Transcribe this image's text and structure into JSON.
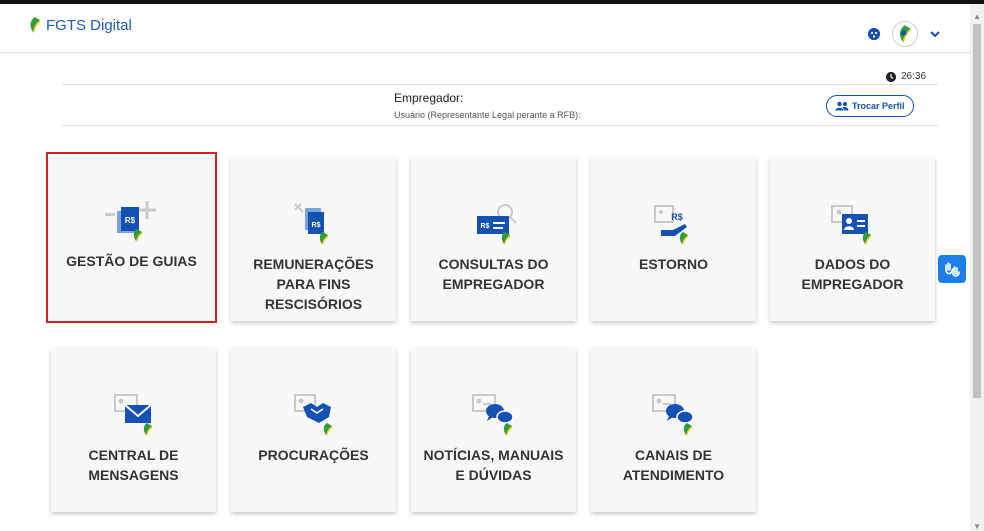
{
  "header": {
    "brand": "FGTS Digital",
    "logo_icon": "fgts-leaf-logo",
    "accessibility_icon": "accessibility-icon",
    "avatar_icon": "user-avatar-icon",
    "menu_icon": "chevron-down-icon"
  },
  "session": {
    "timer": "26:36"
  },
  "profile": {
    "label": "Empregador:",
    "subtitle": "Usuário (Representante Legal perante a RFB):",
    "switch_button": "Trocar Perfil"
  },
  "cards": [
    {
      "lines": [
        "GESTÃO DE GUIAS"
      ],
      "icon": "guide-management-icon",
      "selected": true
    },
    {
      "lines": [
        "REMUNERAÇÕES",
        "PARA FINS",
        "RESCISÓRIOS"
      ],
      "icon": "remuneration-icon"
    },
    {
      "lines": [
        "CONSULTAS DO",
        "EMPREGADOR"
      ],
      "icon": "employer-query-icon"
    },
    {
      "lines": [
        "ESTORNO"
      ],
      "icon": "refund-icon"
    },
    {
      "lines": [
        "DADOS DO",
        "EMPREGADOR"
      ],
      "icon": "employer-data-icon"
    },
    {
      "lines": [
        "CENTRAL DE",
        "MENSAGENS"
      ],
      "icon": "message-center-icon"
    },
    {
      "lines": [
        "PROCURAÇÕES"
      ],
      "icon": "power-of-attorney-icon"
    },
    {
      "lines": [
        "NOTÍCIAS, MANUAIS",
        "E DÚVIDAS"
      ],
      "icon": "news-manuals-icon"
    },
    {
      "lines": [
        "CANAIS DE",
        "ATENDIMENTO"
      ],
      "icon": "service-channels-icon"
    }
  ],
  "colors": {
    "primary": "#1351b4",
    "selected_border": "#d32020",
    "card_bg": "#f8f8f8",
    "libras_button": "#1c7ee8"
  },
  "floating": {
    "icon": "libras-hands-icon"
  }
}
